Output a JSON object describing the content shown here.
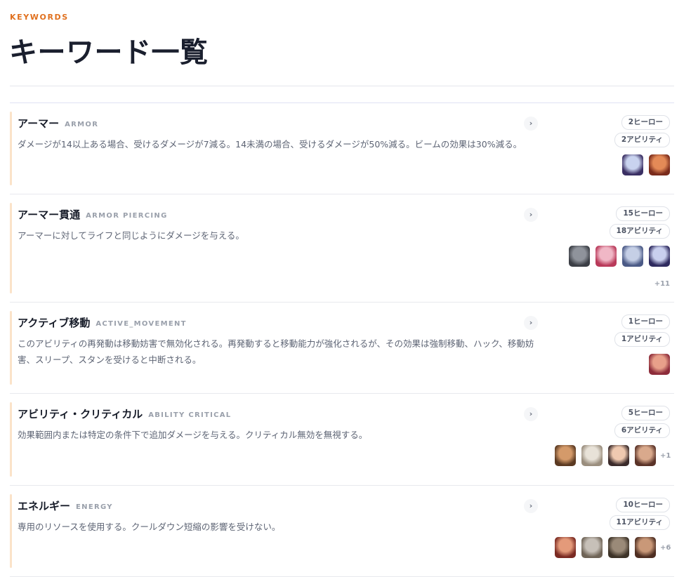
{
  "header": {
    "eyebrow": "KEYWORDS",
    "title": "キーワード一覧"
  },
  "keywords": [
    {
      "name": "アーマー",
      "tag": "ARMOR",
      "description": "ダメージが14以上ある場合、受けるダメージが7減る。14未満の場合、受けるダメージが50%減る。ビームの効果は30%減る。",
      "heroes_count": "2ヒーロー",
      "abilities_count": "2アビリティ",
      "heroes": [
        {
          "icon": "hero-portrait-icon",
          "colors": [
            "#c9d3ef",
            "#3a2f63"
          ]
        },
        {
          "icon": "hero-portrait-icon",
          "colors": [
            "#e48a57",
            "#7a2b1c"
          ]
        }
      ],
      "more": ""
    },
    {
      "name": "アーマー貫通",
      "tag": "ARMOR PIERCING",
      "description": "アーマーに対してライフと同じようにダメージを与える。",
      "heroes_count": "15ヒーロー",
      "abilities_count": "18アビリティ",
      "heroes": [
        {
          "icon": "hero-portrait-icon",
          "colors": [
            "#8f939b",
            "#3b3e45"
          ]
        },
        {
          "icon": "hero-portrait-icon",
          "colors": [
            "#f0b7c6",
            "#b93a5a"
          ]
        },
        {
          "icon": "hero-portrait-icon",
          "colors": [
            "#c5cfe6",
            "#4b5a86"
          ]
        },
        {
          "icon": "hero-portrait-icon",
          "colors": [
            "#c9cfee",
            "#2e2a5e"
          ]
        }
      ],
      "more": "+11"
    },
    {
      "name": "アクティブ移動",
      "tag": "ACTIVE_MOVEMENT",
      "description": "このアビリティの再発動は移動妨害で無効化される。再発動すると移動能力が強化されるが、その効果は強制移動、ハック、移動妨害、スリープ、スタンを受けると中断される。",
      "heroes_count": "1ヒーロー",
      "abilities_count": "1アビリティ",
      "heroes": [
        {
          "icon": "hero-portrait-icon",
          "colors": [
            "#e8a08a",
            "#8d2c3a"
          ]
        }
      ],
      "more": ""
    },
    {
      "name": "アビリティ・クリティカル",
      "tag": "ABILITY CRITICAL",
      "description": "効果範囲内または特定の条件下で追加ダメージを与える。クリティカル無効を無視する。",
      "heroes_count": "5ヒーロー",
      "abilities_count": "6アビリティ",
      "heroes": [
        {
          "icon": "hero-portrait-icon",
          "colors": [
            "#d49a6a",
            "#5b3a22"
          ]
        },
        {
          "icon": "hero-portrait-icon",
          "colors": [
            "#e8e2d8",
            "#9a8e7e"
          ]
        },
        {
          "icon": "hero-portrait-icon",
          "colors": [
            "#efc9b0",
            "#3a2a2a"
          ]
        },
        {
          "icon": "hero-portrait-icon",
          "colors": [
            "#d9a98c",
            "#5a3328"
          ]
        }
      ],
      "more": "+1"
    },
    {
      "name": "エネルギー",
      "tag": "ENERGY",
      "description": "専用のリソースを使用する。クールダウン短縮の影響を受けない。",
      "heroes_count": "10ヒーロー",
      "abilities_count": "11アビリティ",
      "heroes": [
        {
          "icon": "hero-portrait-icon",
          "colors": [
            "#e49a7a",
            "#7a2a22"
          ]
        },
        {
          "icon": "hero-portrait-icon",
          "colors": [
            "#c7c0b8",
            "#6f6457"
          ]
        },
        {
          "icon": "hero-portrait-icon",
          "colors": [
            "#9a8a78",
            "#3d3328"
          ]
        },
        {
          "icon": "hero-portrait-icon",
          "colors": [
            "#c99878",
            "#4e2e22"
          ]
        }
      ],
      "more": "+6"
    }
  ]
}
